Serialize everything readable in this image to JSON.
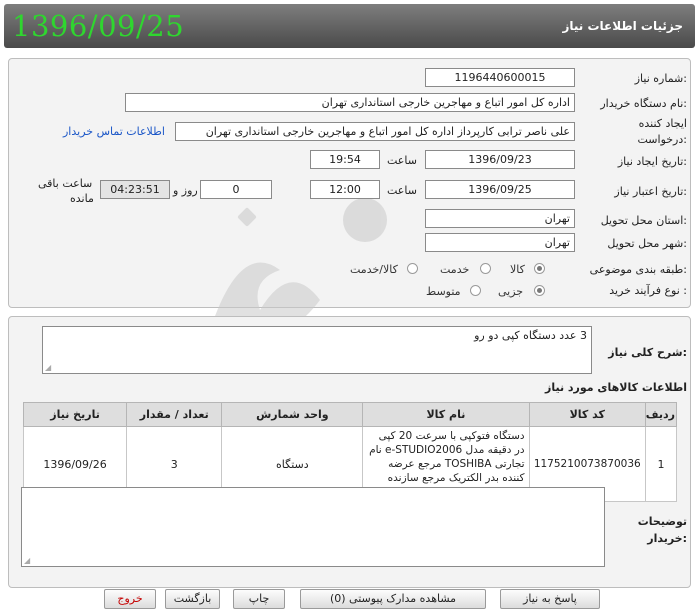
{
  "header": {
    "title": "جزئیات اطلاعات نیاز",
    "date_display": "1396/09/25"
  },
  "form": {
    "need_number_label": "شماره نیاز:",
    "need_number": "1196440600015",
    "buyer_label": "نام دستگاه خریدار:",
    "buyer": "اداره کل امور اتباع و مهاجرین خارجی استانداری تهران",
    "requester_label_1": "ایجاد کننده",
    "requester_label_2": "درخواست:",
    "requester": "علی ناصر ترابی کارپرداز اداره کل امور اتباع و مهاجرین خارجی استانداری تهران",
    "contact_link": "اطلاعات تماس خریدار",
    "created_label": "تاریخ ایجاد نیاز:",
    "created_date": "1396/09/23",
    "time_label": "ساعت",
    "created_time": "19:54",
    "validity_label": "تاریخ اعتبار نیاز:",
    "validity_date": "1396/09/25",
    "validity_time": "12:00",
    "days_value": "0",
    "days_label": "روز و",
    "remaining_time": "04:23:51",
    "remaining_label_1": "ساعت باقی",
    "remaining_label_2": "مانده",
    "province_label": "استان محل تحویل:",
    "province": "تهران",
    "city_label": "شهر محل تحویل:",
    "city": "تهران",
    "category_label": "طبقه بندی موضوعی:",
    "category_options": [
      "کالا",
      "خدمت",
      "کالا/خدمت"
    ],
    "category_selected": "کالا",
    "process_label": "نوع فرآیند خرید :",
    "process_options": [
      "جزیی",
      "متوسط"
    ],
    "process_selected": "جزیی"
  },
  "description": {
    "label": "شرح کلی نیاز:",
    "text": "3 عدد دستگاه کپی دو رو"
  },
  "items_section": {
    "title": "اطلاعات کالاهای مورد نیاز",
    "columns": [
      "ردیف",
      "کد کالا",
      "نام کالا",
      "واحد شمارش",
      "تعداد / مقدار",
      "تاریخ نیاز"
    ],
    "rows": [
      {
        "row": "1",
        "code": "1175210073870036",
        "name": "دستگاه فتوکپی با سرعت 20 کپی در دقیقه مدل e-STUDIO2006 نام تجارتی TOSHIBA مرجع عرضه کننده بدر الکتریک مرجع سازنده TOSHIBA چین",
        "unit": "دستگاه",
        "qty": "3",
        "date": "1396/09/26"
      }
    ]
  },
  "buyer_notes": {
    "label_1": "توضیحات",
    "label_2": "خریدار:",
    "text": ""
  },
  "buttons": {
    "reply": "پاسخ به نیاز",
    "attachments": "مشاهده مدارک پیوستی (0)",
    "print": "چاپ",
    "back": "بازگشت",
    "exit": "خروج"
  },
  "colors": {
    "header_bg": "#5e5e5e",
    "date_green": "#2fd62f",
    "link_blue": "#1a56c7",
    "exit_red": "#c40000"
  }
}
